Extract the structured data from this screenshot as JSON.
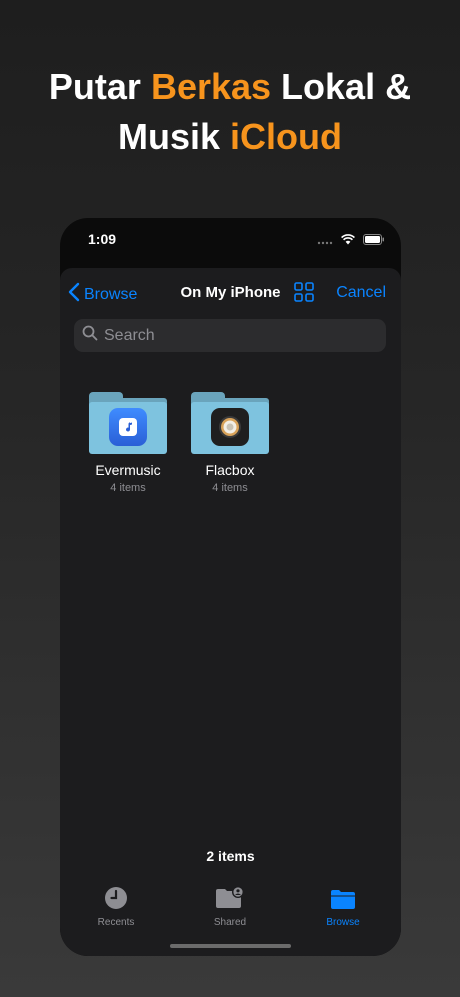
{
  "headline": {
    "line1_a": "Putar ",
    "line1_b": "Berkas",
    "line1_c": " Lokal &",
    "line2_a": "Musik ",
    "line2_b": "iCloud"
  },
  "status": {
    "time": "1:09"
  },
  "nav": {
    "back_label": "Browse",
    "title": "On My iPhone",
    "cancel_label": "Cancel"
  },
  "search": {
    "placeholder": "Search"
  },
  "files": [
    {
      "name": "Evermusic",
      "count": "4 items",
      "icon": "evermusic-app-icon"
    },
    {
      "name": "Flacbox",
      "count": "4 items",
      "icon": "flacbox-app-icon"
    }
  ],
  "footer": {
    "item_count": "2 items"
  },
  "tabs": [
    {
      "label": "Recents",
      "icon": "clock-icon",
      "active": false
    },
    {
      "label": "Shared",
      "icon": "shared-folder-icon",
      "active": false
    },
    {
      "label": "Browse",
      "icon": "folder-icon",
      "active": true
    }
  ],
  "colors": {
    "accent": "#0a84ff",
    "highlight": "#f7941d",
    "sheet": "#1c1c1e"
  }
}
